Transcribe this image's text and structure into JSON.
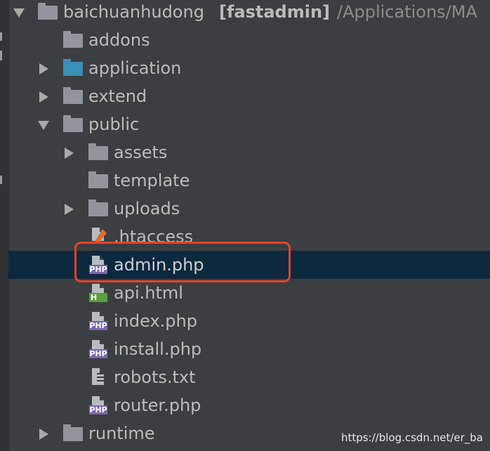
{
  "project": {
    "name": "baichuanhudong",
    "module": "[fastadmin]",
    "path": "/Applications/MA"
  },
  "tree": {
    "addons": "addons",
    "application": "application",
    "extend": "extend",
    "public": "public",
    "assets": "assets",
    "template": "template",
    "uploads": "uploads",
    "htaccess": ".htaccess",
    "admin_php": "admin.php",
    "api_html": "api.html",
    "index_php": "index.php",
    "install_php": "install.php",
    "robots_txt": "robots.txt",
    "router_php": "router.php",
    "runtime": "runtime"
  },
  "badges": {
    "php": "PHP",
    "html": "H"
  },
  "colors": {
    "selection": "#0d293e",
    "highlight_box": "#e8412c",
    "source_folder": "#3a8fb7",
    "php_badge": "#7b67ad",
    "html_badge": "#5c9d3f"
  },
  "watermark": "https://blog.csdn.net/er_ba"
}
